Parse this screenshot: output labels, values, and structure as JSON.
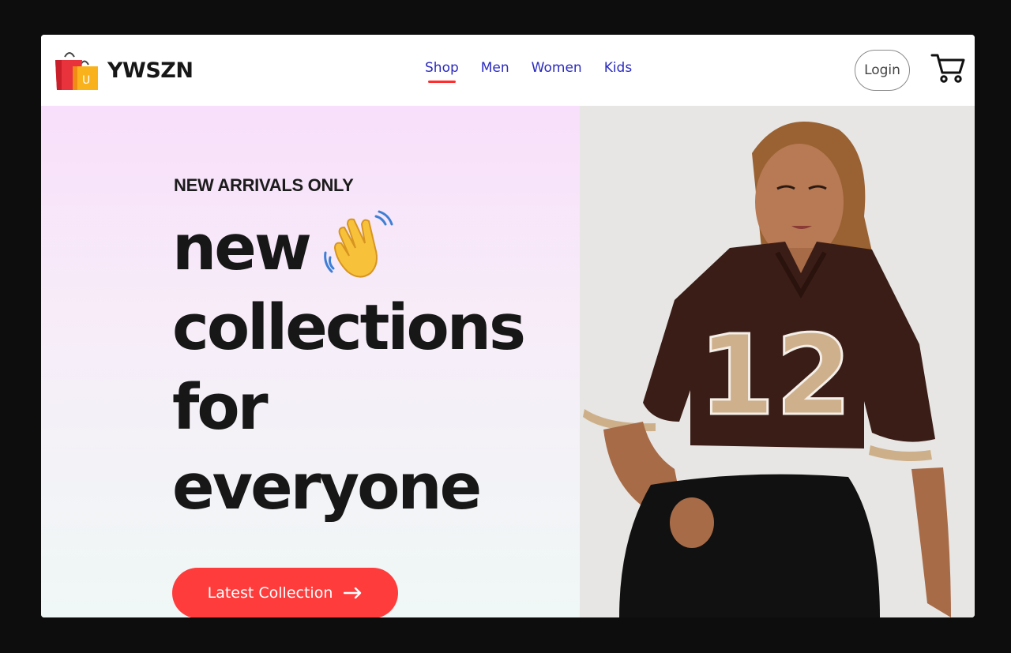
{
  "brand": {
    "name": "YWSZN",
    "logo_icon": "shopping-bags-icon"
  },
  "nav": {
    "items": [
      {
        "label": "Shop",
        "active": true
      },
      {
        "label": "Men",
        "active": false
      },
      {
        "label": "Women",
        "active": false
      },
      {
        "label": "Kids",
        "active": false
      }
    ]
  },
  "header": {
    "login_label": "Login",
    "cart_icon": "cart-icon"
  },
  "hero": {
    "eyebrow": "NEW ARRIVALS ONLY",
    "headline": {
      "line1": "new",
      "line2": "collections",
      "line3": "for",
      "line4": "everyone"
    },
    "emoji": "waving-hand-icon",
    "cta_label": "Latest Collection",
    "cta_icon": "arrow-right-icon",
    "model_jersey_number": "12"
  },
  "colors": {
    "accent": "#ff3c3c",
    "nav_link": "#2b2bbf",
    "nav_active_underline": "#ff2d2d",
    "hero_gradient_top": "#f8dffb",
    "hero_gradient_bottom": "#eff8f6"
  }
}
